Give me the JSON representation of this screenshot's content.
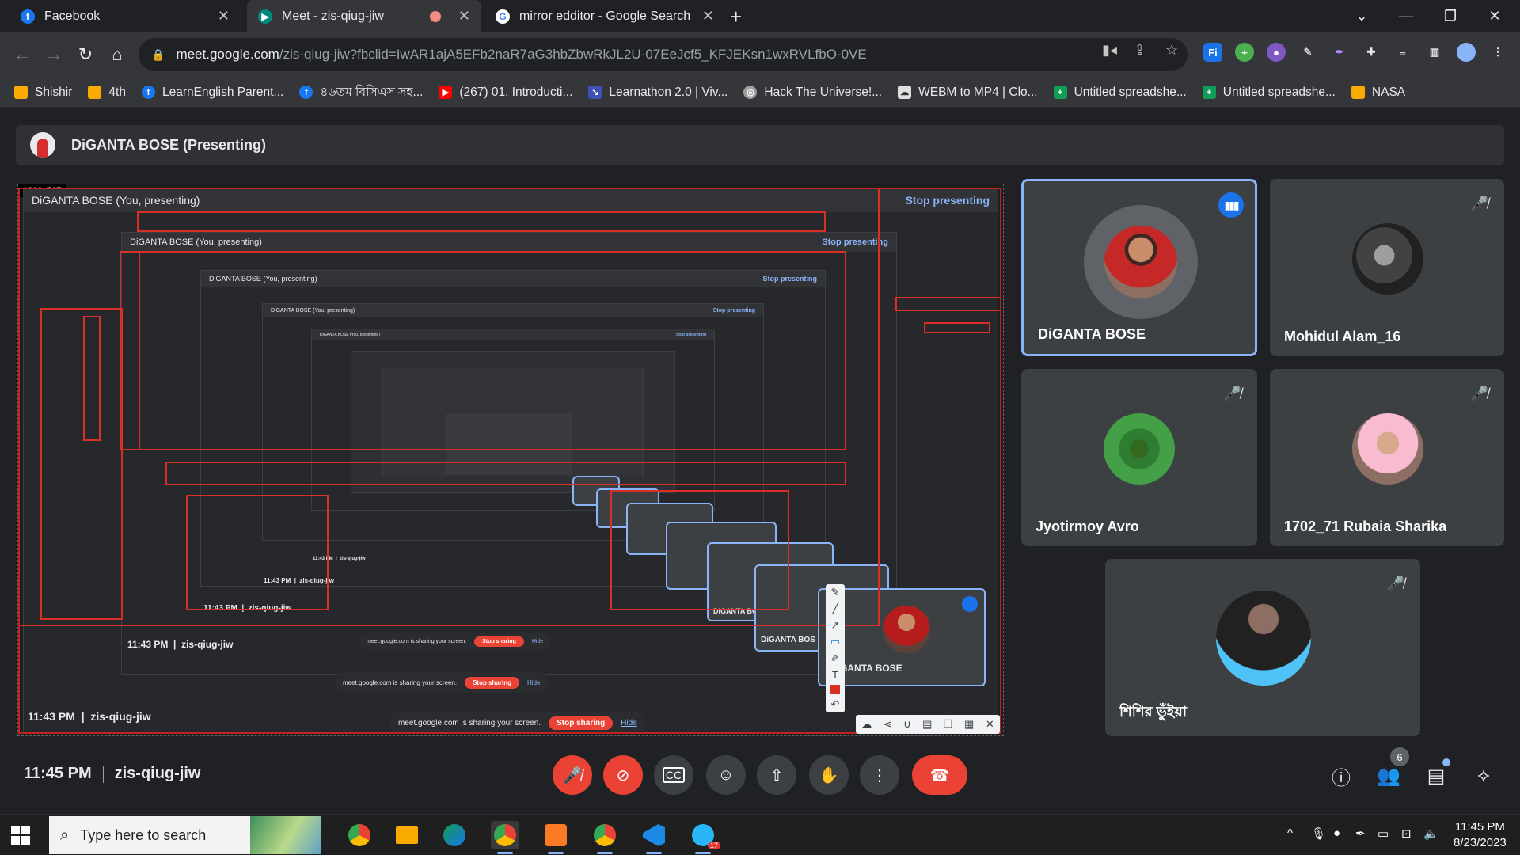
{
  "browser": {
    "tabs": [
      {
        "title": "Facebook",
        "icon": "facebook-icon",
        "color": "#1877f2"
      },
      {
        "title": "Meet - zis-qiug-jiw",
        "icon": "google-meet-icon",
        "color": "#00897b"
      },
      {
        "title": "mirror edditor - Google Search",
        "icon": "google-icon",
        "color": "#4285f4"
      }
    ],
    "url_host": "meet.google.com",
    "url_rest": "/zis-qiug-jiw?fbclid=IwAR1ajA5EFb2naR7aG3hbZbwRkJL2U-07EeJcf5_KFJEKsn1wxRVLfbO-0VE",
    "bookmarks": [
      {
        "label": "Shishir",
        "icon": "folder-icon",
        "color": "#f9ab00"
      },
      {
        "label": "4th",
        "icon": "folder-icon",
        "color": "#f9ab00"
      },
      {
        "label": "LearnEnglish Parent...",
        "icon": "facebook-icon",
        "color": "#1877f2"
      },
      {
        "label": "৪৬তম বিসিএস সহ...",
        "icon": "facebook-icon",
        "color": "#1877f2"
      },
      {
        "label": "(267) 01. Introducti...",
        "icon": "youtube-icon",
        "color": "#ff0000"
      },
      {
        "label": "Learnathon 2.0 | Viv...",
        "icon": "learnathon-icon",
        "color": "#3f51b5"
      },
      {
        "label": "Hack The Universe!...",
        "icon": "hack-icon",
        "color": "#9e9e9e"
      },
      {
        "label": "WEBM to MP4 | Clo...",
        "icon": "cloud-icon",
        "color": "#e0e0e0"
      },
      {
        "label": "Untitled spreadshe...",
        "icon": "sheets-icon",
        "color": "#0f9d58"
      },
      {
        "label": "Untitled spreadshe...",
        "icon": "sheets-icon",
        "color": "#0f9d58"
      },
      {
        "label": "NASA",
        "icon": "folder-icon",
        "color": "#f9ab00"
      }
    ]
  },
  "meet": {
    "presenting_banner": "DiGANTA BOSE (Presenting)",
    "share": {
      "dimensions_label": "1363x767",
      "you_presenting": "DiGANTA BOSE (You, presenting)",
      "stop_presenting": "Stop presenting",
      "time_code": "11:43 PM",
      "meeting_code": "zis-qiug-jiw",
      "sharing_text": "meet.google.com is sharing your screen.",
      "stop_sharing": "Stop sharing",
      "hide": "Hide",
      "mini_name_1": "DiGANTA BOSE",
      "mini_name_2": "DiGANTA BOS",
      "participant_count": "6"
    },
    "participants": [
      {
        "name": "DiGANTA BOSE",
        "speaking": true
      },
      {
        "name": "Mohidul Alam_16",
        "speaking": false
      },
      {
        "name": "Jyotirmoy Avro",
        "speaking": false
      },
      {
        "name": "1702_71 Rubaia Sharika",
        "speaking": false
      },
      {
        "name": "শিশির ভুঁইয়া",
        "speaking": false
      }
    ],
    "time": "11:45 PM",
    "meeting_code": "zis-qiug-jiw",
    "people_count": "6",
    "colors": {
      "accent": "#8ab4f8",
      "danger": "#ea4335",
      "speaking": "#1a73e8"
    }
  },
  "taskbar": {
    "search_placeholder": "Type here to search",
    "time": "11:45 PM",
    "date": "8/23/2023",
    "telegram_badge": "17"
  }
}
